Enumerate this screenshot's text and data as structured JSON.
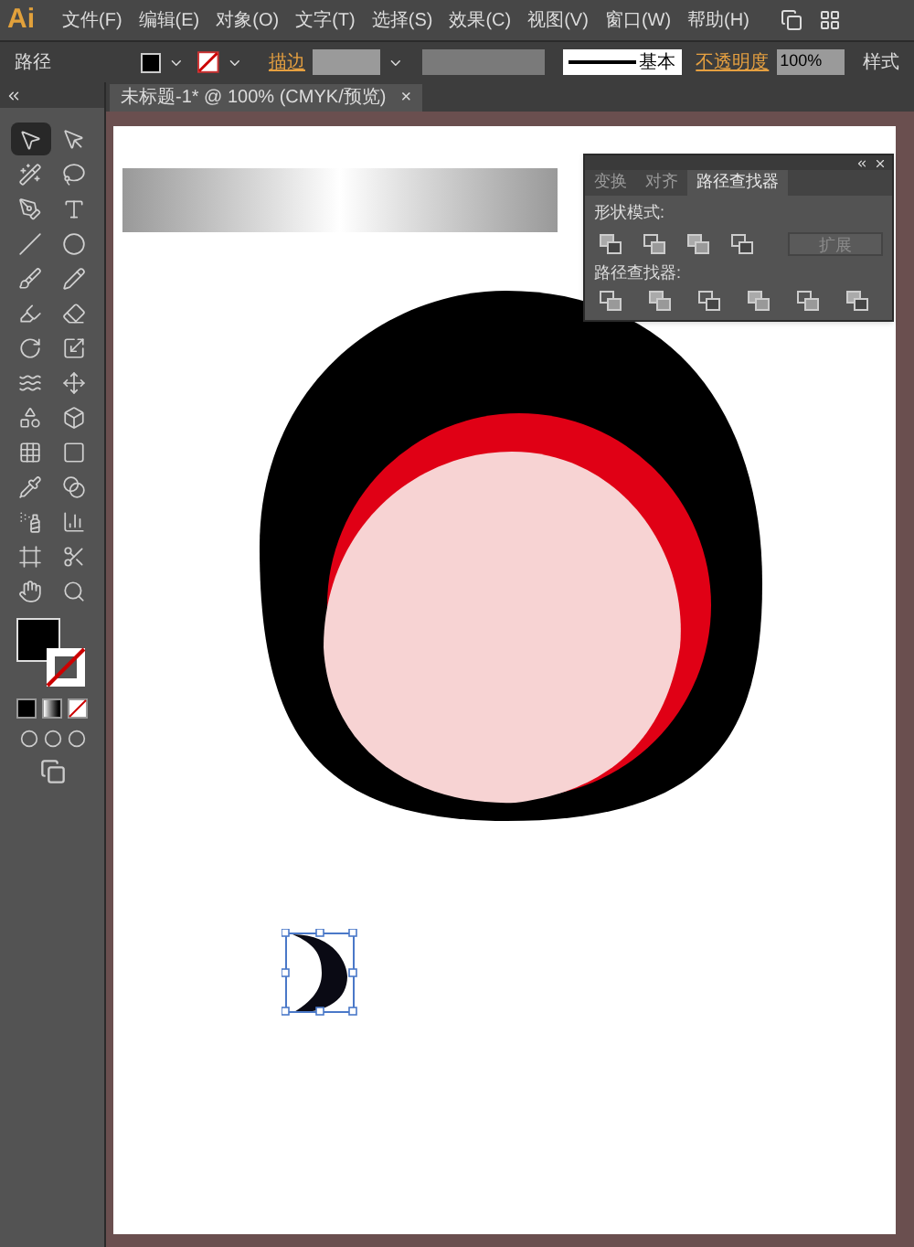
{
  "menu_bar": {
    "logo": "Ai",
    "items": [
      "文件(F)",
      "编辑(E)",
      "对象(O)",
      "文字(T)",
      "选择(S)",
      "效果(C)",
      "视图(V)",
      "窗口(W)",
      "帮助(H)"
    ]
  },
  "control_bar": {
    "object_type": "路径",
    "stroke_label": "描边",
    "stroke_style": "基本",
    "opacity_label": "不透明度",
    "opacity_value": "100%",
    "style_label": "样式"
  },
  "document_tab": {
    "title": "未标题-1* @ 100% (CMYK/预览)",
    "close": "×"
  },
  "tools": [
    {
      "kind": "select",
      "selected": true
    },
    {
      "kind": "direct",
      "selected": false
    },
    {
      "kind": "wand",
      "selected": false
    },
    {
      "kind": "lasso",
      "selected": false
    },
    {
      "kind": "pen",
      "selected": false
    },
    {
      "kind": "type",
      "selected": false
    },
    {
      "kind": "line",
      "selected": false
    },
    {
      "kind": "ellipse",
      "selected": false
    },
    {
      "kind": "brush",
      "selected": false
    },
    {
      "kind": "pencil",
      "selected": false
    },
    {
      "kind": "blob",
      "selected": false
    },
    {
      "kind": "eraser",
      "selected": false
    },
    {
      "kind": "rotate",
      "selected": false
    },
    {
      "kind": "scale",
      "selected": false
    },
    {
      "kind": "warp",
      "selected": false
    },
    {
      "kind": "transform",
      "selected": false
    },
    {
      "kind": "shapebuilder",
      "selected": false
    },
    {
      "kind": "perspective",
      "selected": false
    },
    {
      "kind": "mesh",
      "selected": false
    },
    {
      "kind": "gradient",
      "selected": false
    },
    {
      "kind": "eyedropper",
      "selected": false
    },
    {
      "kind": "blend",
      "selected": false
    },
    {
      "kind": "spray",
      "selected": false
    },
    {
      "kind": "graph",
      "selected": false
    },
    {
      "kind": "artboard",
      "selected": false
    },
    {
      "kind": "slice",
      "selected": false
    },
    {
      "kind": "hand",
      "selected": false
    },
    {
      "kind": "zoom",
      "selected": false
    }
  ],
  "pathfinder_panel": {
    "tabs": [
      {
        "label": "变换",
        "selected": false
      },
      {
        "label": "对齐",
        "selected": false
      },
      {
        "label": "路径查找器",
        "selected": true
      }
    ],
    "shape_modes_label": "形状模式:",
    "expand_button": {
      "label": "扩展",
      "disabled": true
    },
    "pathfinders_label": "路径查找器:"
  }
}
